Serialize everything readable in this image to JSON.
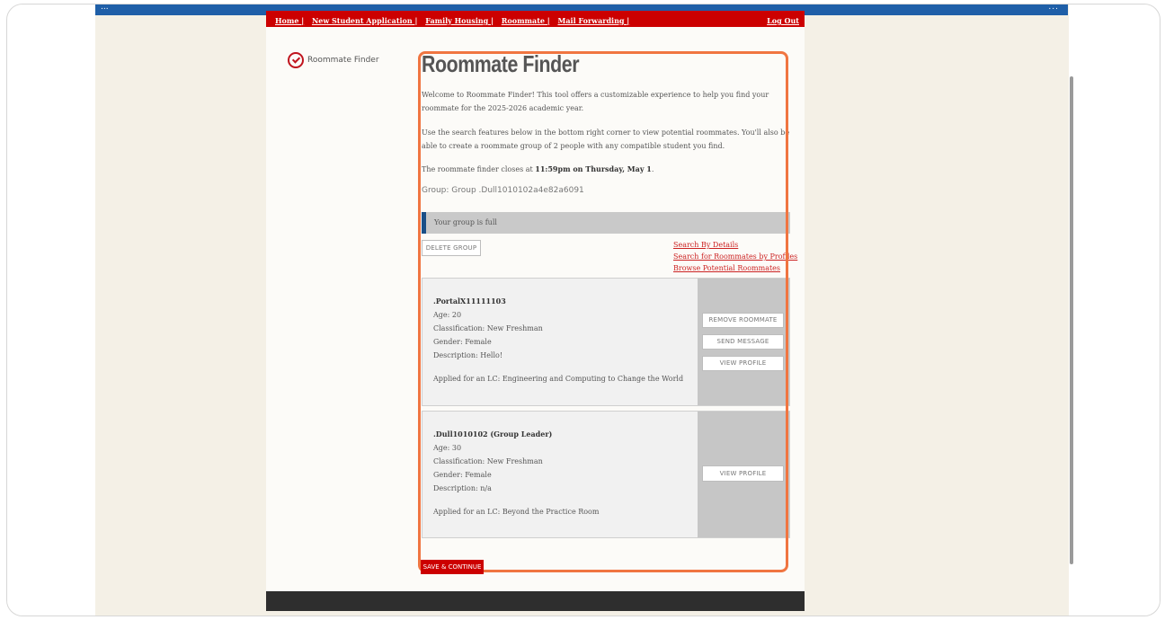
{
  "browser": {
    "left_text": "...",
    "right_text": "..."
  },
  "topnav": {
    "items": [
      "Home |",
      "New Student Application |",
      "Family Housing |",
      "Roommate |",
      "Mail Forwarding |"
    ],
    "logout": "Log Out"
  },
  "steps": [
    {
      "label": "Roommate Finder",
      "icon": "check-circle-icon"
    }
  ],
  "page": {
    "title": "Roommate Finder",
    "intro1": "Welcome to Roommate Finder! This tool offers a customizable experience to help you find your roommate for the 2025-2026 academic year.",
    "intro2": "Use the search features below in the bottom right corner to view potential roommates. You'll also be able to create a roommate group of 2 people with any compatible student you find.",
    "closes_prefix": "The roommate finder closes at ",
    "closes_time": "11:59pm on Thursday, May 1",
    "closes_suffix": ".",
    "group": "Group: Group .Dull1010102a4e82a6091",
    "alert": "Your group is full",
    "delete_group": "DELETE GROUP",
    "links": [
      "Search By Details",
      "Search for Roommates by Profiles",
      "Browse Potential Roommates"
    ],
    "save": "SAVE & CONTINUE"
  },
  "roommates": [
    {
      "name": ".PortalX11111103",
      "age": "Age: 20",
      "classification": "Classification: New Freshman",
      "gender": "Gender: Female",
      "description": "Description: Hello!",
      "lc": "Applied for an LC: Engineering and Computing to Change the World",
      "actions": [
        "REMOVE ROOMMATE",
        "SEND MESSAGE",
        "VIEW PROFILE"
      ]
    },
    {
      "name": ".Dull1010102 (Group Leader)",
      "age": "Age: 30",
      "classification": "Classification: New Freshman",
      "gender": "Gender: Female",
      "description": "Description: n/a",
      "lc": "Applied for an LC: Beyond the Practice Room",
      "actions": [
        "VIEW PROFILE"
      ]
    }
  ],
  "colors": {
    "accent_red": "#cc0000",
    "highlight": "#f07541",
    "alert_bar": "#1a4f87"
  }
}
